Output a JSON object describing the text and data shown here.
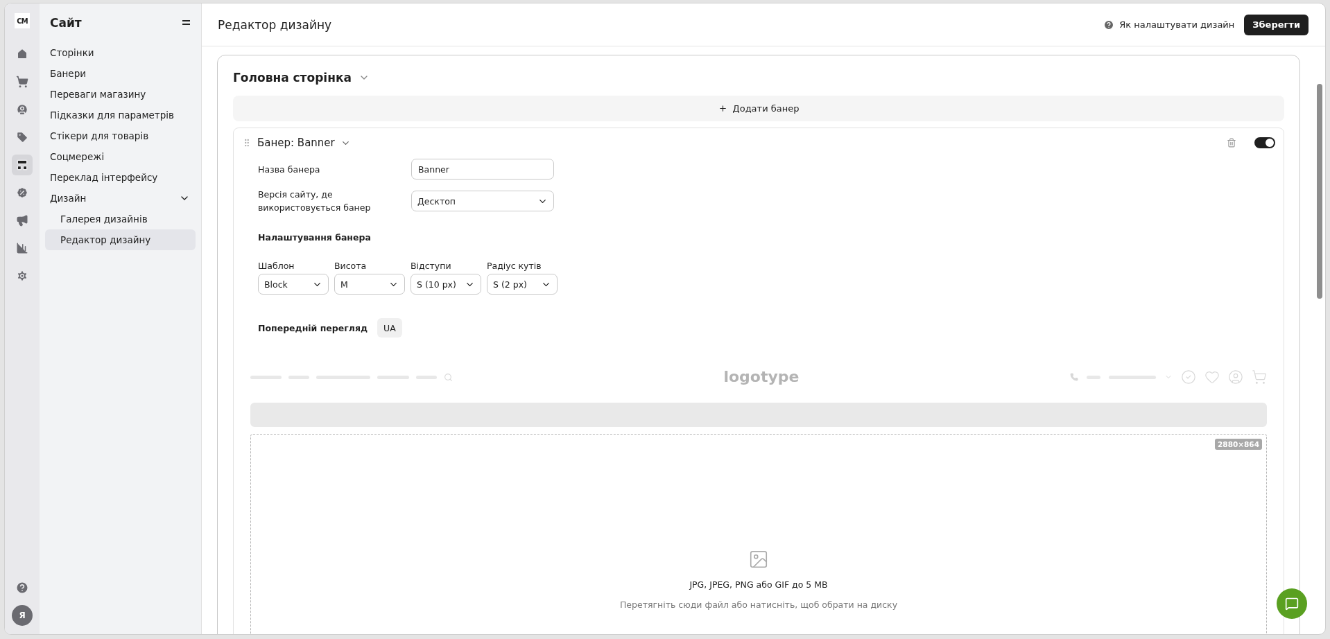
{
  "rail": {
    "logo": "CM",
    "items": [
      {
        "kind": "home",
        "selected": false
      },
      {
        "kind": "cart",
        "selected": false
      },
      {
        "kind": "user",
        "selected": false
      },
      {
        "kind": "tag",
        "selected": false
      },
      {
        "kind": "layout",
        "selected": true
      },
      {
        "kind": "discount",
        "selected": false
      },
      {
        "kind": "megaphone",
        "selected": false
      },
      {
        "kind": "chart",
        "selected": false
      },
      {
        "kind": "settings",
        "selected": false
      }
    ],
    "avatar": "Я"
  },
  "sidebar": {
    "title": "Сайт",
    "items": [
      {
        "label": "Сторінки",
        "selected": false
      },
      {
        "label": "Банери",
        "selected": false
      },
      {
        "label": "Переваги магазину",
        "selected": false
      },
      {
        "label": "Підказки для параметрів",
        "selected": false
      },
      {
        "label": "Стікери для товарів",
        "selected": false
      },
      {
        "label": "Соцмережі",
        "selected": false
      },
      {
        "label": "Переклад інтерфейсу",
        "selected": false
      },
      {
        "label": "Дизайн",
        "selected": false,
        "expanded": true,
        "children": [
          {
            "label": "Галерея дизайнів",
            "selected": false
          },
          {
            "label": "Редактор дизайну",
            "selected": true
          }
        ]
      }
    ]
  },
  "header": {
    "title": "Редактор дизайну",
    "help_link": "Як налаштувати дизайн",
    "save_button": "Зберегти"
  },
  "page_section": {
    "title": "Головна сторінка",
    "add_button": "Додати банер",
    "banner": {
      "title": "Банер: Banner",
      "enabled": true,
      "fields": [
        {
          "label": "Назва банера",
          "kind": "text",
          "value": "Banner"
        },
        {
          "label": "Версія сайту, де використовується банер",
          "kind": "select",
          "value": "Десктоп"
        }
      ],
      "settings_title": "Налаштування банера",
      "settings": [
        {
          "label": "Шаблон",
          "value": "Block"
        },
        {
          "label": "Висота",
          "value": "M"
        },
        {
          "label": "Відступи",
          "value": "S (10 px)"
        },
        {
          "label": "Радіус кутів",
          "value": "S (2 px)"
        }
      ],
      "preview_title": "Попередній перегляд",
      "languages": [
        {
          "label": "UA",
          "selected": true
        }
      ],
      "preview": {
        "logo": "logotype",
        "size_badge": "2880×864",
        "upload_formats": "JPG, JPEG, PNG або GIF до 5 MB",
        "upload_hint": "Перетягніть сюди файл або натисніть, щоб обрати на диску"
      }
    }
  }
}
